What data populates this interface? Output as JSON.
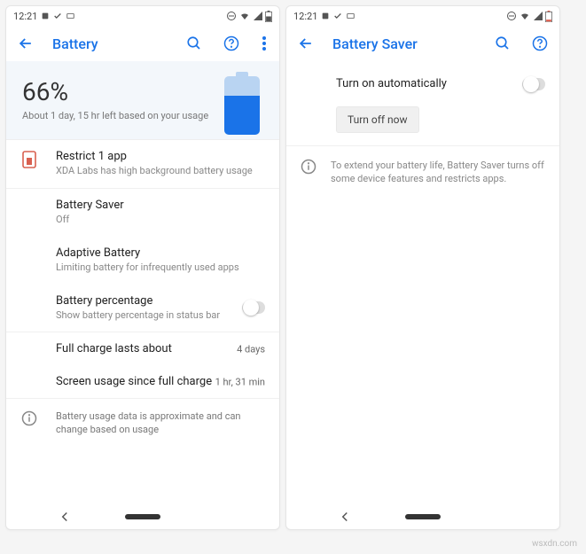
{
  "status": {
    "time": "12:21"
  },
  "left": {
    "title": "Battery",
    "hero": {
      "percent": "66%",
      "estimate": "About 1 day, 15 hr left based on your usage"
    },
    "rows": {
      "restrict_title": "Restrict 1 app",
      "restrict_sub": "XDA Labs has high background battery usage",
      "saver_title": "Battery Saver",
      "saver_sub": "Off",
      "adaptive_title": "Adaptive Battery",
      "adaptive_sub": "Limiting battery for infrequently used apps",
      "pct_title": "Battery percentage",
      "pct_sub": "Show battery percentage in status bar",
      "fullcharge_title": "Full charge lasts about",
      "fullcharge_value": "4 days",
      "screenusage_title": "Screen usage since full charge",
      "screenusage_value": "1 hr, 31 min",
      "info": "Battery usage data is approximate and can change based on usage"
    }
  },
  "right": {
    "title": "Battery Saver",
    "auto_label": "Turn on automatically",
    "turnoff_label": "Turn off now",
    "info": "To extend your battery life, Battery Saver turns off some device features and restricts apps."
  },
  "watermark": "wsxdn.com"
}
